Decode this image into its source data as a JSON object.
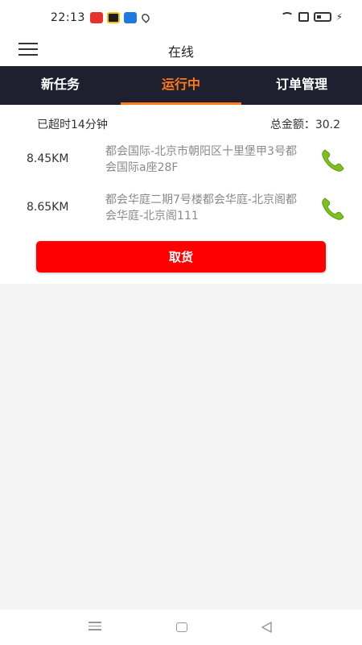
{
  "status_bar": {
    "time": "22:13",
    "icons": [
      "app-red-icon",
      "app-yellow-icon",
      "app-blue-icon",
      "location-icon",
      "wifi-icon",
      "sim-icon",
      "battery-icon",
      "charging-icon"
    ]
  },
  "header": {
    "title": "在线"
  },
  "tabs": [
    {
      "label": "新任务",
      "active": false
    },
    {
      "label": "运行中",
      "active": true
    },
    {
      "label": "订单管理",
      "active": false
    }
  ],
  "summary": {
    "overtime": "已超时14分钟",
    "total": "总金额：30.2"
  },
  "orders": [
    {
      "distance": "8.45KM",
      "address": "都会国际-北京市朝阳区十里堡甲3号都会国际a座28F"
    },
    {
      "distance": "8.65KM",
      "address": "都会华庭二期7号楼都会华庭-北京阁都会华庭-北京阁111"
    }
  ],
  "pickup_button": {
    "label": "取货"
  },
  "colors": {
    "tab_bar_bg": "#1e2030",
    "active_tab": "#ff7a1a",
    "primary_button": "#ff0000",
    "phone_icon": "#7cc21c"
  }
}
